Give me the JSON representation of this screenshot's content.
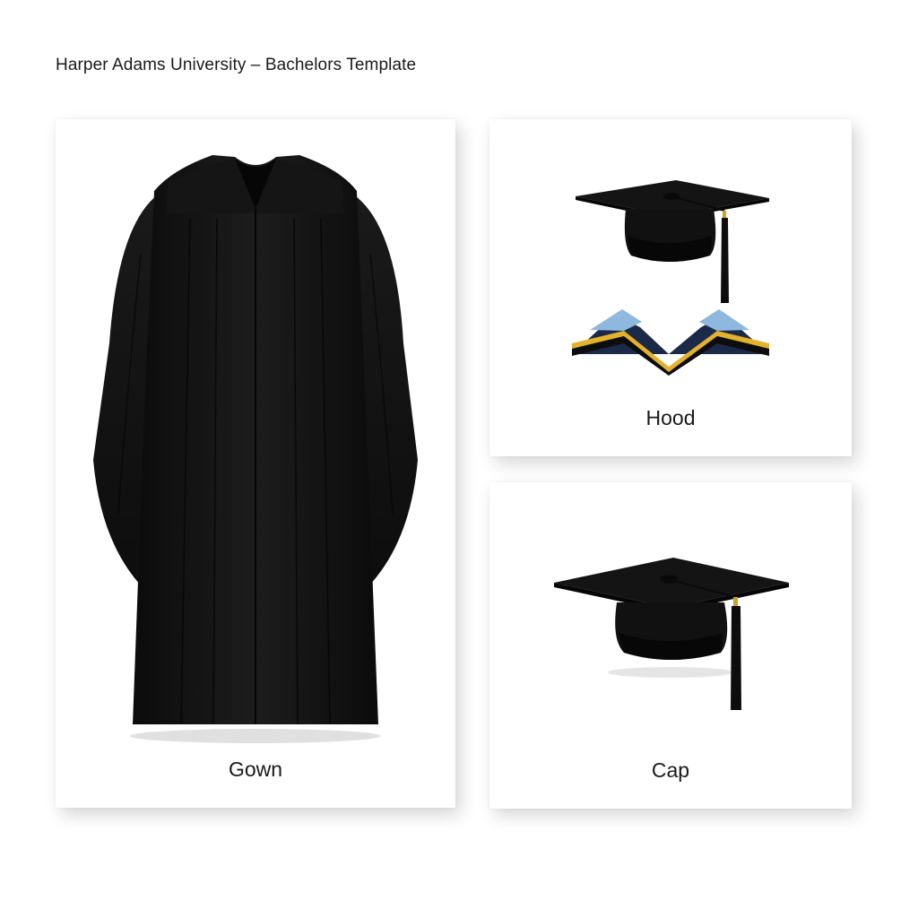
{
  "page": {
    "title": "Harper Adams University – Bachelors Template"
  },
  "items": {
    "gown": {
      "label": "Gown",
      "icon": "gown-icon"
    },
    "hood": {
      "label": "Hood",
      "icon": "hood-icon"
    },
    "cap": {
      "label": "Cap",
      "icon": "cap-icon"
    }
  },
  "colors": {
    "fabric_black": "#111111",
    "hood_navy": "#1c2a4a",
    "hood_light_blue": "#8fb8de",
    "hood_gold": "#e3b22a",
    "tassel_gold": "#c9a227"
  }
}
